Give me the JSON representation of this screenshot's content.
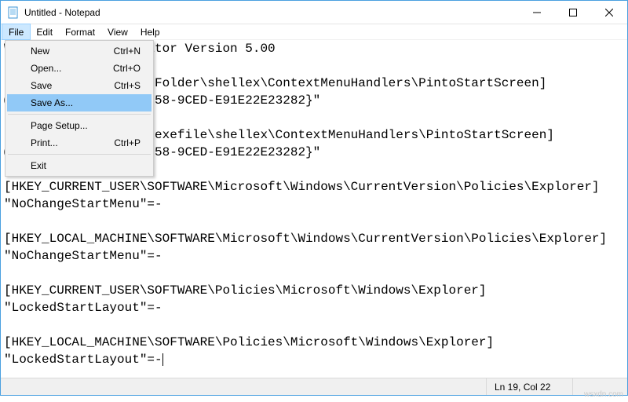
{
  "window": {
    "title": "Untitled - Notepad"
  },
  "menubar": {
    "items": [
      "File",
      "Edit",
      "Format",
      "View",
      "Help"
    ],
    "open_index": 0
  },
  "file_menu": {
    "items": [
      {
        "label": "New",
        "shortcut": "Ctrl+N",
        "selected": false
      },
      {
        "label": "Open...",
        "shortcut": "Ctrl+O",
        "selected": false
      },
      {
        "label": "Save",
        "shortcut": "Ctrl+S",
        "selected": false
      },
      {
        "label": "Save As...",
        "shortcut": "",
        "selected": true
      },
      {
        "separator": true
      },
      {
        "label": "Page Setup...",
        "shortcut": "",
        "selected": false
      },
      {
        "label": "Print...",
        "shortcut": "Ctrl+P",
        "selected": false
      },
      {
        "separator": true
      },
      {
        "label": "Exit",
        "shortcut": "",
        "selected": false
      }
    ]
  },
  "editor": {
    "text": "Windows Registry Editor Version 5.00\n\n[-HKEY_CLASSES_ROOT\\Folder\\shellex\\ContextMenuHandlers\\PintoStartScreen]\n@=\"{470C0EBD-5D73-4d58-9CED-E91E22E23282}\"\n\n[-HKEY_CLASSES_ROOT\\exefile\\shellex\\ContextMenuHandlers\\PintoStartScreen]\n@=\"{470C0EBD-5D73-4d58-9CED-E91E22E23282}\"\n\n[HKEY_CURRENT_USER\\SOFTWARE\\Microsoft\\Windows\\CurrentVersion\\Policies\\Explorer]\n\"NoChangeStartMenu\"=-\n\n[HKEY_LOCAL_MACHINE\\SOFTWARE\\Microsoft\\Windows\\CurrentVersion\\Policies\\Explorer]\n\"NoChangeStartMenu\"=-\n\n[HKEY_CURRENT_USER\\SOFTWARE\\Policies\\Microsoft\\Windows\\Explorer]\n\"LockedStartLayout\"=-\n\n[HKEY_LOCAL_MACHINE\\SOFTWARE\\Policies\\Microsoft\\Windows\\Explorer]\n\"LockedStartLayout\"=-"
  },
  "status": {
    "position": "Ln 19, Col 22"
  },
  "watermark": "wsxdn.com"
}
